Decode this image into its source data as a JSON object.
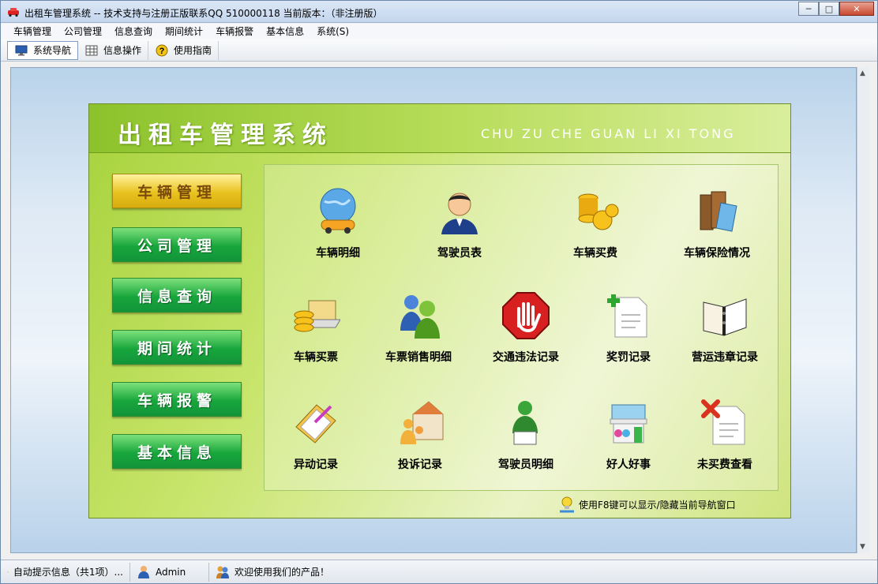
{
  "window": {
    "title": "出租车管理系统 -- 技术支持与注册正版联系QQ 510000118   当前版本：（非注册版）",
    "controls": {
      "minimize": "─",
      "maximize": "□",
      "close": "✕"
    }
  },
  "menu": [
    "车辆管理",
    "公司管理",
    "信息查询",
    "期间统计",
    "车辆报警",
    "基本信息",
    "系统(S)"
  ],
  "toolbar": {
    "tabs": [
      {
        "label": "系统导航",
        "icon": "monitor-icon",
        "active": true
      },
      {
        "label": "信息操作",
        "icon": "grid-icon",
        "active": false
      },
      {
        "label": "使用指南",
        "icon": "help-icon",
        "active": false
      }
    ]
  },
  "panel": {
    "title": "出租车管理系统",
    "subtitle": "CHU ZU CHE GUAN LI XI TONG",
    "nav": [
      {
        "label": "车辆管理",
        "active": true
      },
      {
        "label": "公司管理",
        "active": false
      },
      {
        "label": "信息查询",
        "active": false
      },
      {
        "label": "期间统计",
        "active": false
      },
      {
        "label": "车辆报警",
        "active": false
      },
      {
        "label": "基本信息",
        "active": false
      }
    ],
    "row1": [
      {
        "label": "车辆明细",
        "icon": "globe-car-icon"
      },
      {
        "label": "驾驶员表",
        "icon": "driver-icon"
      },
      {
        "label": "车辆买费",
        "icon": "coins-icon"
      },
      {
        "label": "车辆保险情况",
        "icon": "books-icon"
      }
    ],
    "row2": [
      {
        "label": "车辆买票",
        "icon": "laptop-coins-icon"
      },
      {
        "label": "车票销售明细",
        "icon": "users-icon"
      },
      {
        "label": "交通违法记录",
        "icon": "stop-hand-icon"
      },
      {
        "label": "奖罚记录",
        "icon": "document-plus-icon"
      },
      {
        "label": "营运违章记录",
        "icon": "binder-icon"
      }
    ],
    "row3": [
      {
        "label": "异动记录",
        "icon": "clipboard-icon"
      },
      {
        "label": "投诉记录",
        "icon": "house-people-icon"
      },
      {
        "label": "驾驶员明细",
        "icon": "reader-icon"
      },
      {
        "label": "好人好事",
        "icon": "store-icon"
      },
      {
        "label": "未买费查看",
        "icon": "document-x-icon"
      }
    ],
    "hint": "使用F8键可以显示/隐藏当前导航窗口"
  },
  "status": {
    "auto_info": "自动提示信息（共1项）...",
    "user": "Admin",
    "welcome": "欢迎使用我们的产品！"
  }
}
